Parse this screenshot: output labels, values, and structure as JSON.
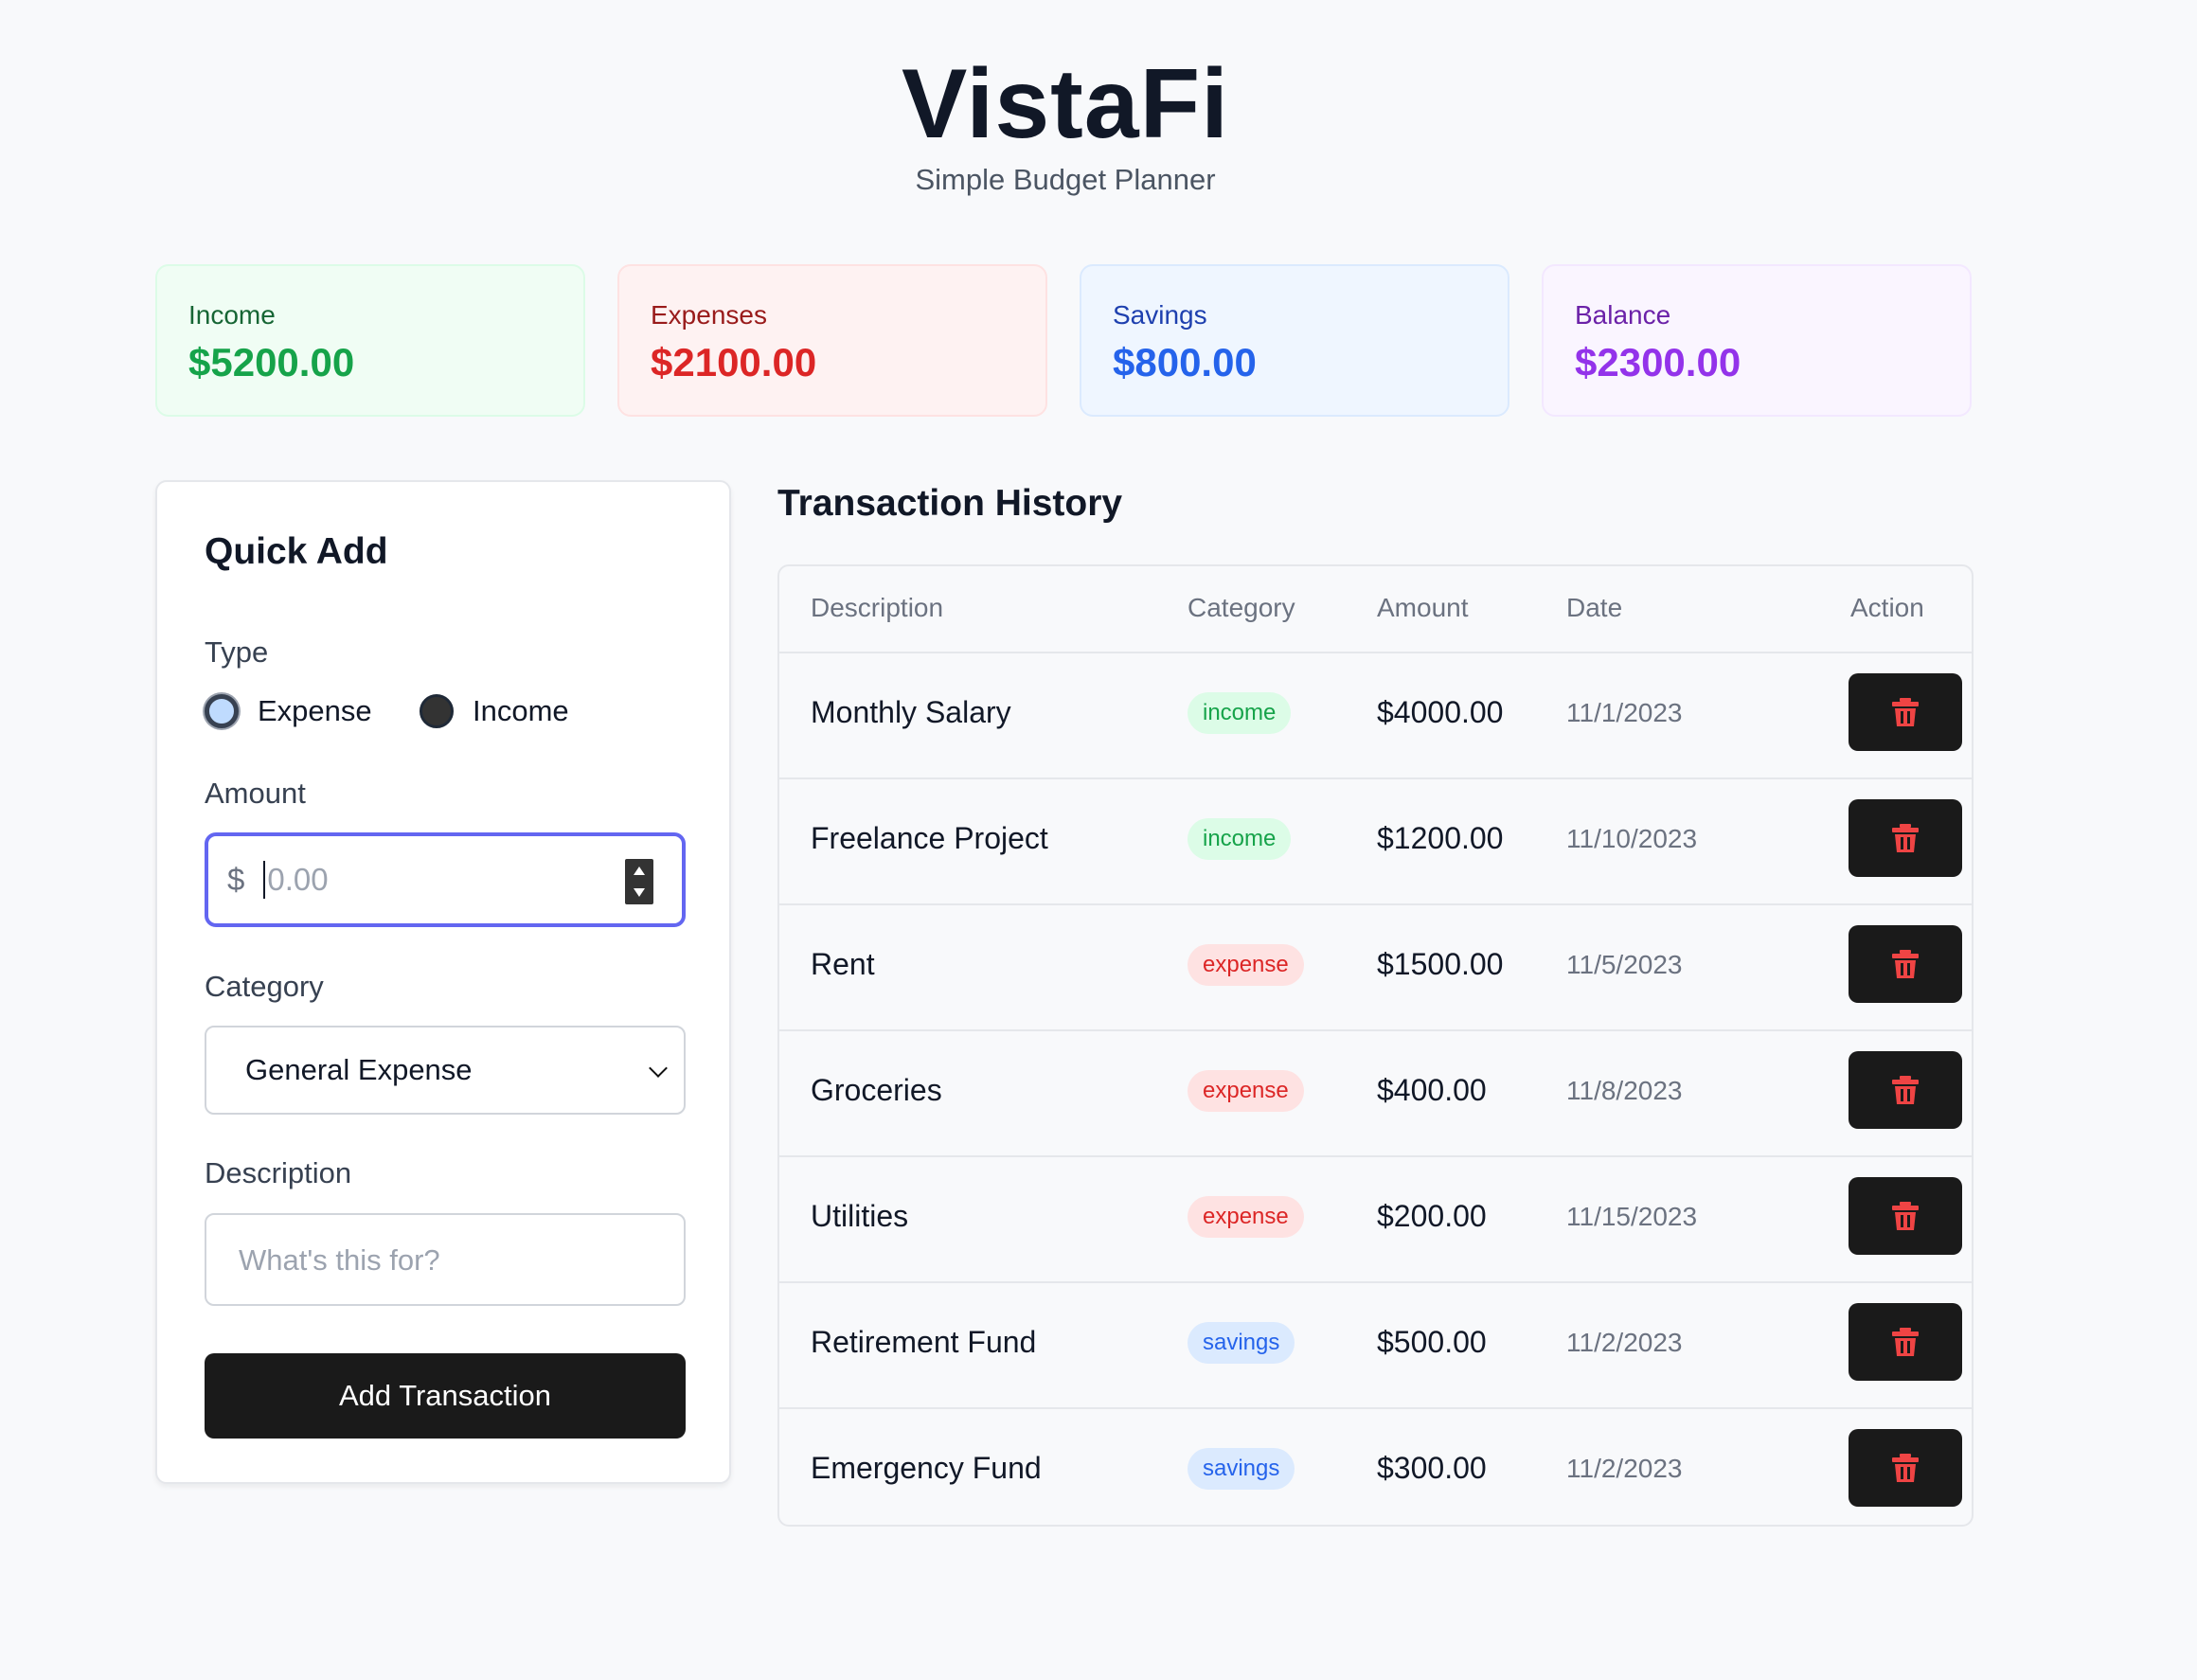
{
  "app": {
    "title": "VistaFi",
    "subtitle": "Simple Budget Planner"
  },
  "summary": {
    "income": {
      "label": "Income",
      "value": "$5200.00"
    },
    "expenses": {
      "label": "Expenses",
      "value": "$2100.00"
    },
    "savings": {
      "label": "Savings",
      "value": "$800.00"
    },
    "balance": {
      "label": "Balance",
      "value": "$2300.00"
    }
  },
  "quick_add": {
    "title": "Quick Add",
    "type_label": "Type",
    "type_options": [
      "Expense",
      "Income"
    ],
    "type_selected": "Expense",
    "amount_label": "Amount",
    "amount_currency": "$",
    "amount_placeholder": "0.00",
    "category_label": "Category",
    "category_selected": "General Expense",
    "description_label": "Description",
    "description_placeholder": "What's this for?",
    "submit_label": "Add Transaction"
  },
  "history": {
    "title": "Transaction History",
    "columns": [
      "Description",
      "Category",
      "Amount",
      "Date",
      "Action"
    ],
    "rows": [
      {
        "description": "Monthly Salary",
        "category": "income",
        "amount": "$4000.00",
        "date": "11/1/2023"
      },
      {
        "description": "Freelance Project",
        "category": "income",
        "amount": "$1200.00",
        "date": "11/10/2023"
      },
      {
        "description": "Rent",
        "category": "expense",
        "amount": "$1500.00",
        "date": "11/5/2023"
      },
      {
        "description": "Groceries",
        "category": "expense",
        "amount": "$400.00",
        "date": "11/8/2023"
      },
      {
        "description": "Utilities",
        "category": "expense",
        "amount": "$200.00",
        "date": "11/15/2023"
      },
      {
        "description": "Retirement Fund",
        "category": "savings",
        "amount": "$500.00",
        "date": "11/2/2023"
      },
      {
        "description": "Emergency Fund",
        "category": "savings",
        "amount": "$300.00",
        "date": "11/2/2023"
      }
    ],
    "delete_icon": "trash-icon"
  },
  "colors": {
    "income": "#16a34a",
    "expense": "#dc2626",
    "savings": "#2563eb",
    "balance": "#9333ea",
    "accent_focus": "#6366f1",
    "button_dark": "#1a1a1a"
  }
}
